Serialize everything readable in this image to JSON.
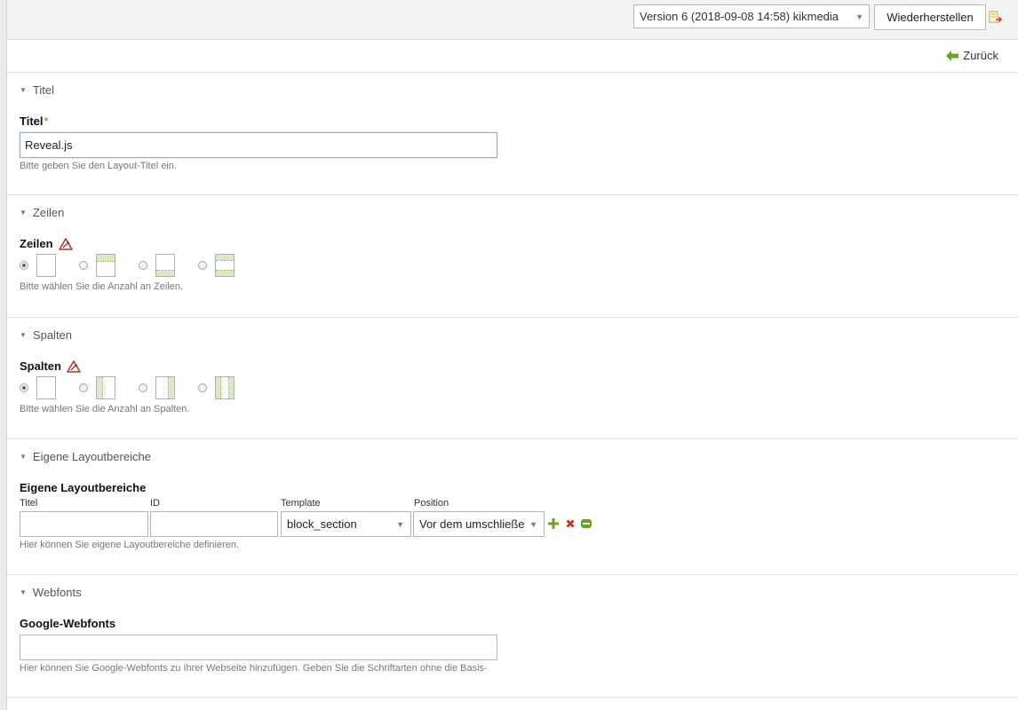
{
  "toolbar": {
    "version_select": "Version 6 (2018-09-08 14:58) kikmedia",
    "restore_label": "Wiederherstellen"
  },
  "back": {
    "label": "Zurück"
  },
  "sections": {
    "titel": {
      "legend": "Titel",
      "field_label": "Titel",
      "required_mark": "*",
      "value": "Reveal.js",
      "help": "Bitte geben Sie den Layout-Titel ein."
    },
    "zeilen": {
      "legend": "Zeilen",
      "field_label": "Zeilen",
      "help": "Bitte wählen Sie die Anzahl an Zeilen.",
      "selected_option": 1
    },
    "spalten": {
      "legend": "Spalten",
      "field_label": "Spalten",
      "help": "Bitte wählen Sie die Anzahl an Spalten.",
      "selected_option": 1
    },
    "layoutbereiche": {
      "legend": "Eigene Layoutbereiche",
      "field_label": "Eigene Layoutbereiche",
      "columns": {
        "titel": "Titel",
        "id": "ID",
        "template": "Template",
        "position": "Position"
      },
      "row": {
        "titel": "",
        "id": "",
        "template": "block_section",
        "position": "Vor dem umschließe"
      },
      "help": "Hier können Sie eigene Layoutbereiche definieren."
    },
    "webfonts": {
      "legend": "Webfonts",
      "field_label": "Google-Webfonts",
      "value": "",
      "help": "Hier können Sie Google-Webfonts zu Ihrer Webseite hinzufügen. Geben Sie die Schriftarten ohne die Basis-"
    }
  },
  "colors": {
    "accent_green": "#6aa323",
    "delete_red": "#c8321e",
    "required_red": "#e04c21",
    "warning_red": "#c0341d",
    "layout_green": "#dbe9c8"
  }
}
